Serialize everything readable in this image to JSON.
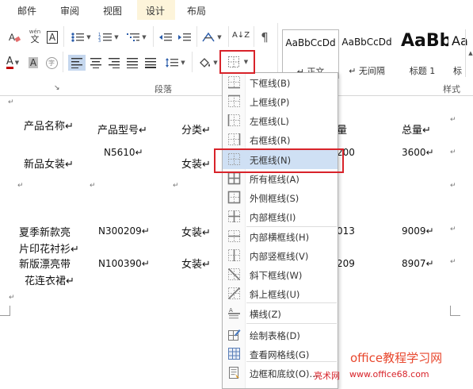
{
  "tabs": [
    {
      "label": "邮件"
    },
    {
      "label": "审阅"
    },
    {
      "label": "视图"
    },
    {
      "label": "设计"
    },
    {
      "label": "布局"
    }
  ],
  "ribbon": {
    "font_a_label": "A",
    "font_a2_label": "A",
    "wen_label": "wén",
    "wen_char": "文",
    "boxed_a": "A",
    "circle_char": "字",
    "sort_label": "A↓Z",
    "pilcrow": "¶",
    "group_paragraph": "段落",
    "group_styles": "样式",
    "dialog_launcher": "↘"
  },
  "styles": [
    {
      "sample": "AaBbCcDd",
      "name": "↵ 正文"
    },
    {
      "sample": "AaBbCcDd",
      "name": "↵ 无间隔"
    },
    {
      "sample": "AaBb",
      "name": "标题 1"
    },
    {
      "sample": "Aa",
      "name": "标"
    }
  ],
  "accent": {
    "highlight_red": "#d8232a",
    "font_red": "#c00000",
    "selected_blue": "#c5d7ee"
  },
  "document": {
    "header_row": [
      "产品名称↵",
      "产品型号↵",
      "分类↵",
      "量",
      "总量↵",
      "↵"
    ],
    "row1": [
      "新品女装↵",
      "N5610↵",
      "女装↵",
      "200",
      "3600↵",
      "↵"
    ],
    "row2_marks": [
      "↵",
      "↵",
      "↵",
      "↵"
    ],
    "row3": [
      "夏季新款亮",
      "片印花衬衫↵",
      "N300209↵",
      "女装↵",
      "013",
      "9009↵",
      "↵"
    ],
    "row4": [
      "新版漂亮带",
      "花连衣裙↵",
      "N100390↵",
      "女装↵",
      "209",
      "8907↵",
      "↵"
    ],
    "end_mark": "↵",
    "para_marks": [
      "↵",
      "↵",
      "↵"
    ]
  },
  "menu": {
    "items": [
      {
        "label": "下框线(B)",
        "icon": "bottom-border-icon"
      },
      {
        "label": "上框线(P)",
        "icon": "top-border-icon"
      },
      {
        "label": "左框线(L)",
        "icon": "left-border-icon"
      },
      {
        "label": "右框线(R)",
        "icon": "right-border-icon"
      },
      {
        "label": "无框线(N)",
        "icon": "no-border-icon"
      },
      {
        "label": "所有框线(A)",
        "icon": "all-borders-icon"
      },
      {
        "label": "外侧框线(S)",
        "icon": "outside-borders-icon"
      },
      {
        "label": "内部框线(I)",
        "icon": "inside-borders-icon"
      },
      {
        "label": "内部横框线(H)",
        "icon": "inside-horizontal-border-icon"
      },
      {
        "label": "内部竖框线(V)",
        "icon": "inside-vertical-border-icon"
      },
      {
        "label": "斜下框线(W)",
        "icon": "diagonal-down-border-icon"
      },
      {
        "label": "斜上框线(U)",
        "icon": "diagonal-up-border-icon"
      },
      {
        "label": "横线(Z)",
        "icon": "horizontal-line-icon"
      },
      {
        "label": "绘制表格(D)",
        "icon": "draw-table-icon"
      },
      {
        "label": "查看网格线(G)",
        "icon": "view-gridlines-icon"
      },
      {
        "label": "边框和底纹(O)...",
        "icon": "borders-shading-icon"
      }
    ]
  },
  "watermark": {
    "line1": "office教程学习网",
    "line2a": "亮术网",
    "line2b": "www.office68.com"
  }
}
